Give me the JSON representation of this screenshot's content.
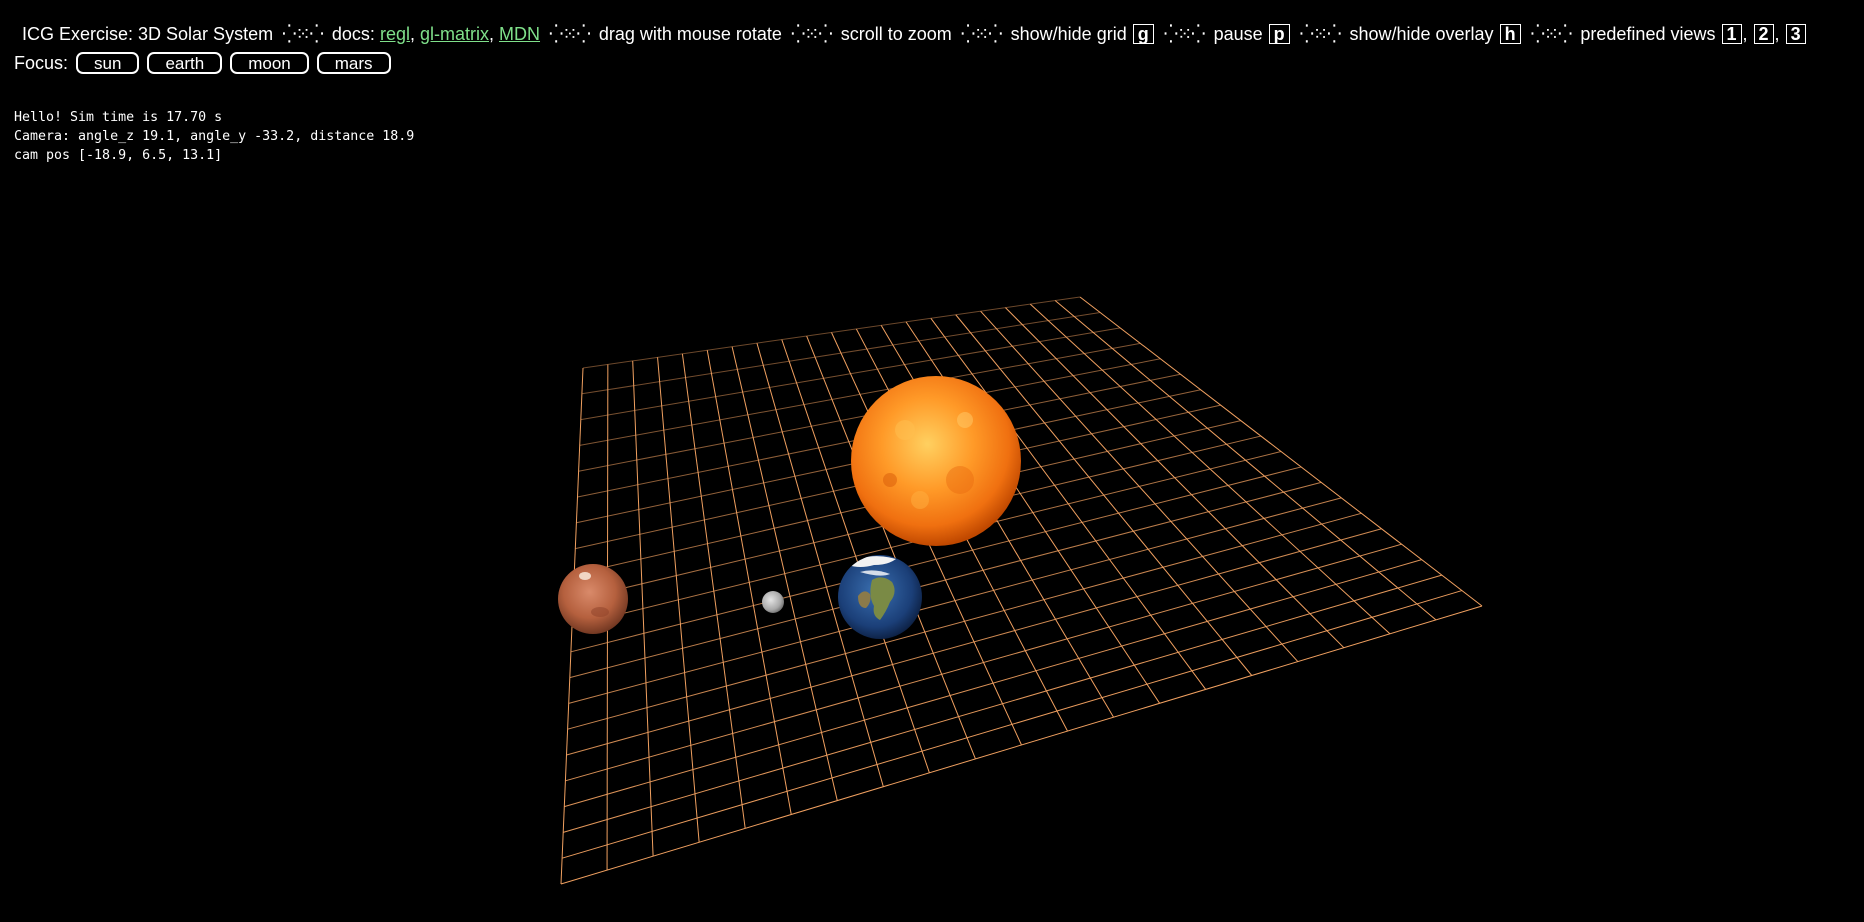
{
  "header": {
    "title": "ICG Exercise: 3D Solar System",
    "separator": "⁛⁙⁛",
    "docs_label": "docs:",
    "links": [
      {
        "label": "regl"
      },
      {
        "label": "gl-matrix"
      },
      {
        "label": "MDN"
      }
    ],
    "rotate_text": "drag with mouse rotate",
    "zoom_text": "scroll to zoom",
    "grid_text": "show/hide grid",
    "grid_key": "g",
    "pause_text": "pause",
    "pause_key": "p",
    "overlay_text": "show/hide overlay",
    "overlay_key": "h",
    "views_text": "predefined views",
    "view_keys": [
      "1",
      "2",
      "3"
    ]
  },
  "focus": {
    "label": "Focus:",
    "buttons": [
      "sun",
      "earth",
      "moon",
      "mars"
    ]
  },
  "overlay": {
    "line1": "Hello! Sim time is 17.70 s",
    "line2": "Camera: angle_z 19.1, angle_y -33.2, distance 18.9",
    "line3": "cam pos [-18.9, 6.5, 13.1]"
  },
  "scene": {
    "grid_color": "#f0a060",
    "background": "#000000",
    "bodies": [
      "sun",
      "earth",
      "moon",
      "mars"
    ]
  }
}
